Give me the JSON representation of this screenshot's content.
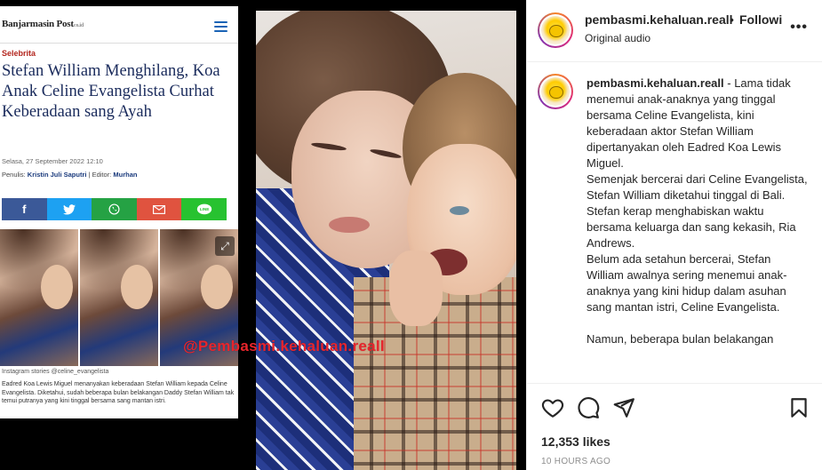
{
  "article": {
    "logo": "Banjarmasin",
    "logo_post": "Post",
    "logo_sub": "co.id",
    "category": "Selebrita",
    "title": "Stefan William Menghilang, Koa Anak Celine Evangelista Curhat Keberadaan sang Ayah",
    "date": "Selasa, 27 September 2022 12:10",
    "author_prefix": "Penulis:",
    "author": "Kristin Juli Saputri",
    "editor_prefix": "| Editor:",
    "editor": "Murhan",
    "share_buttons": [
      {
        "icon": "facebook-icon",
        "glyph": "f",
        "color": "#3b5998"
      },
      {
        "icon": "twitter-icon",
        "glyph": "🐦",
        "color": "#1da1f2"
      },
      {
        "icon": "whatsapp-icon",
        "glyph": "✆",
        "color": "#25a244"
      },
      {
        "icon": "mail-icon",
        "glyph": "✉",
        "color": "#e0533f"
      },
      {
        "icon": "line-icon",
        "glyph": "LINE",
        "color": "#27c230"
      }
    ],
    "photo_caption": "Instagram stories @celine_evangelista",
    "body": "Eadred Koa Lewis Miguel menanyakan keberadaan Stefan William kepada Celine Evangelista. Diketahui, sudah beberapa bulan belakangan Daddy Stefan William tak temui putranya yang kini tinggal bersama sang mantan istri."
  },
  "video": {
    "watermark": "@Pembasmi.kehaluan.reall"
  },
  "post": {
    "username": "pembasmi.kehaluan.reall",
    "separator": "•",
    "follow_label": "Following",
    "audio": "Original audio",
    "more_label": "•••",
    "caption_user": "pembasmi.kehaluan.reall",
    "caption_lines": [
      "- Lama tidak menemui anak-anaknya yang tinggal bersama Celine Evangelista, kini keberadaan aktor Stefan William dipertanyakan oleh Eadred Koa Lewis Miguel.",
      "Semenjak bercerai dari Celine Evangelista, Stefan William diketahui tinggal di Bali.",
      "Stefan kerap menghabiskan waktu bersama keluarga dan sang kekasih, Ria Andrews.",
      "Belum ada setahun bercerai, Stefan William awalnya sering menemui anak-anaknya yang kini hidup dalam asuhan sang mantan istri, Celine Evangelista.",
      "",
      "Namun, beberapa bulan belakangan"
    ],
    "likes": "12,353 likes",
    "time": "10 HOURS AGO"
  }
}
